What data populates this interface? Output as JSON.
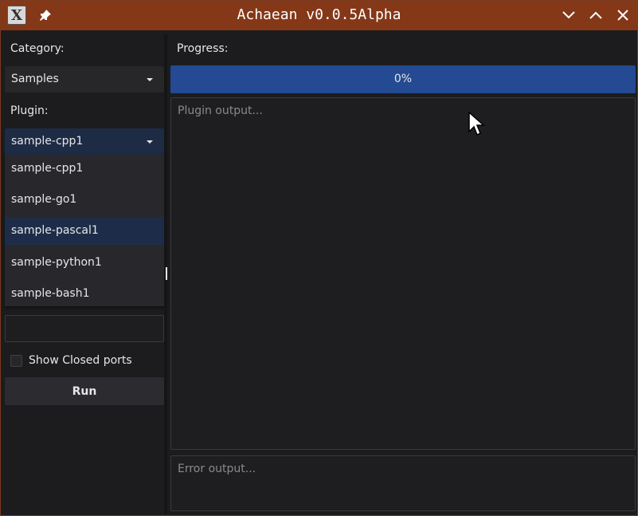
{
  "window": {
    "title": "Achaean v0.0.5Alpha",
    "app_icon_glyph": "X",
    "border_color": "#7a3a20",
    "titlebar_color": "#843818"
  },
  "left": {
    "category_label": "Category:",
    "category_value": "Samples",
    "plugin_label": "Plugin:",
    "plugin_value": "sample-cpp1",
    "plugin_options": [
      "sample-cpp1",
      "sample-go1",
      "sample-pascal1",
      "sample-python1",
      "sample-bash1"
    ],
    "plugin_highlighted_option": "sample-pascal1",
    "target_input_value": "",
    "show_closed_ports_label": "Show Closed ports",
    "show_closed_ports_checked": false,
    "run_label": "Run"
  },
  "right": {
    "progress_label": "Progress:",
    "progress_text": "0%",
    "progress_percent": 0,
    "progress_color": "#234a92",
    "output_placeholder": "Plugin output...",
    "error_placeholder": "Error output..."
  },
  "icons": {
    "app": "x-window-icon",
    "pin": "pin-icon",
    "minimize": "chevron-down-icon",
    "maximize": "chevron-up-icon",
    "close": "close-icon",
    "caret": "caret-down-icon",
    "cursor": "mouse-pointer-icon"
  }
}
